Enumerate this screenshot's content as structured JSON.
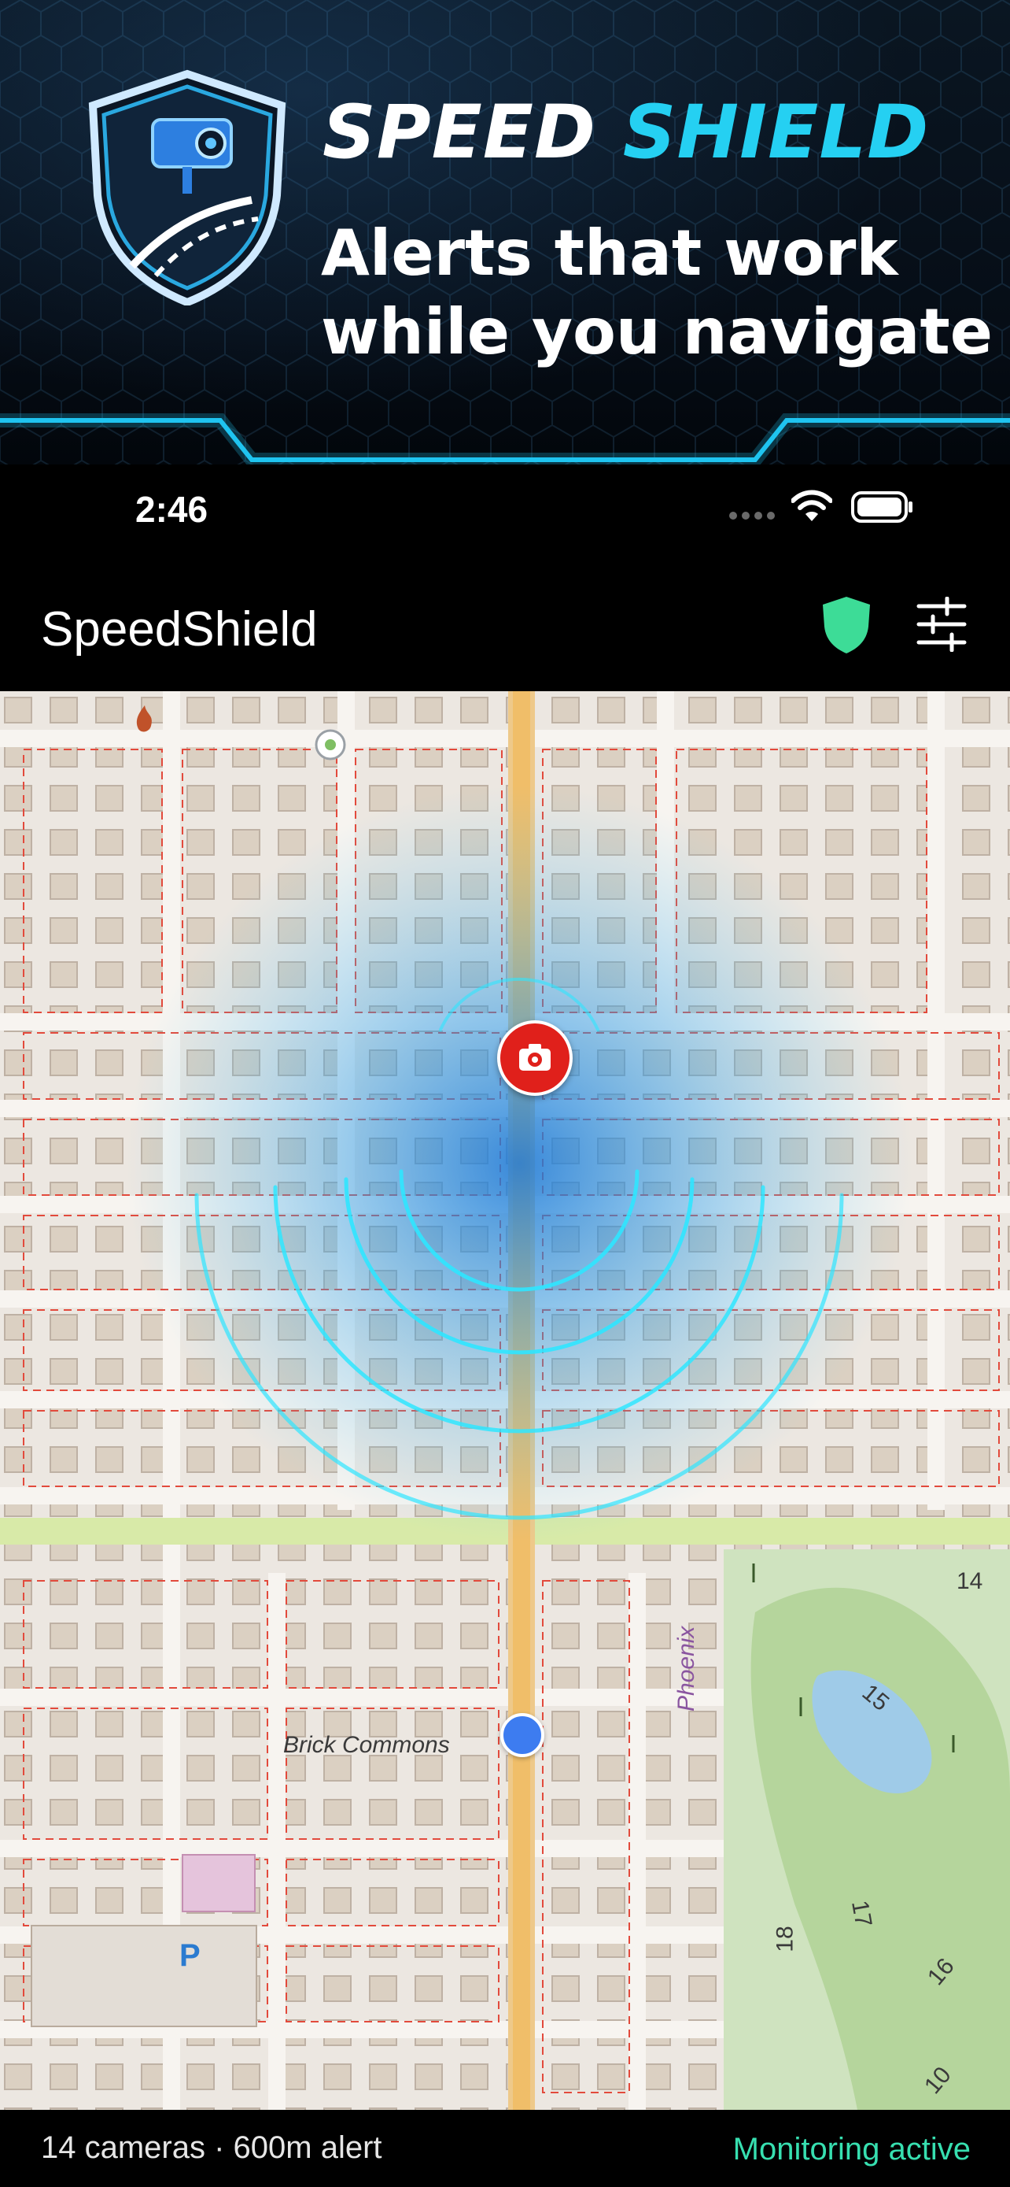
{
  "promo": {
    "title_word_1": "SPEED",
    "title_word_2": "SHIELD",
    "tagline_line_1": "Alerts that work",
    "tagline_line_2": "while you navigate",
    "accent_color": "#25d0f2"
  },
  "status_bar": {
    "time": "2:46",
    "icons": [
      "signal-dots-icon",
      "wifi-icon",
      "battery-icon"
    ]
  },
  "app_header": {
    "title": "SpeedShield",
    "shield_icon_color": "#3ddc97",
    "icons": [
      "shield-icon",
      "sliders-icon"
    ]
  },
  "map": {
    "labels": {
      "brick_commons": "Brick Commons",
      "phoenix": "Phoenix",
      "parking": "P",
      "golf_14": "14",
      "golf_15": "15",
      "golf_16": "16",
      "golf_17": "17",
      "golf_18": "18",
      "golf_10": "10"
    },
    "markers": [
      "camera-marker",
      "user-location-dot"
    ],
    "camera_marker_color": "#e0201b",
    "user_dot_color": "#3d7cf0",
    "alert_wave_color": "#2fe6ff"
  },
  "bottom_bar": {
    "stats": "14 cameras · 600m alert",
    "status": "Monitoring active",
    "status_color": "#37dfb0"
  }
}
